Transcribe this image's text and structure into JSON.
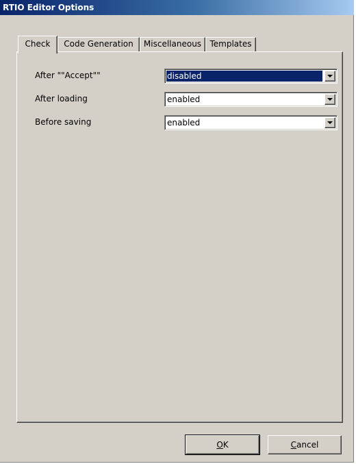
{
  "window": {
    "title": "RTIO Editor Options"
  },
  "tabs": [
    {
      "label": "Check",
      "active": true
    },
    {
      "label": "Code Generation",
      "active": false
    },
    {
      "label": "Miscellaneous",
      "active": false
    },
    {
      "label": "Templates",
      "active": false
    }
  ],
  "check_panel": {
    "rows": [
      {
        "label": "After \"\"Accept\"\"",
        "value": "disabled",
        "selected": true
      },
      {
        "label": "After loading",
        "value": "enabled",
        "selected": false
      },
      {
        "label": "Before saving",
        "value": "enabled",
        "selected": false
      }
    ]
  },
  "buttons": {
    "ok": {
      "mnemonic": "O",
      "rest": "K"
    },
    "cancel": {
      "mnemonic": "C",
      "rest": "ancel"
    }
  },
  "colors": {
    "title_bar": "#0a246a",
    "face": "#d4d0c8",
    "selection": "#0a246a"
  },
  "icons": {
    "dropdown": "chevron-down-icon"
  }
}
